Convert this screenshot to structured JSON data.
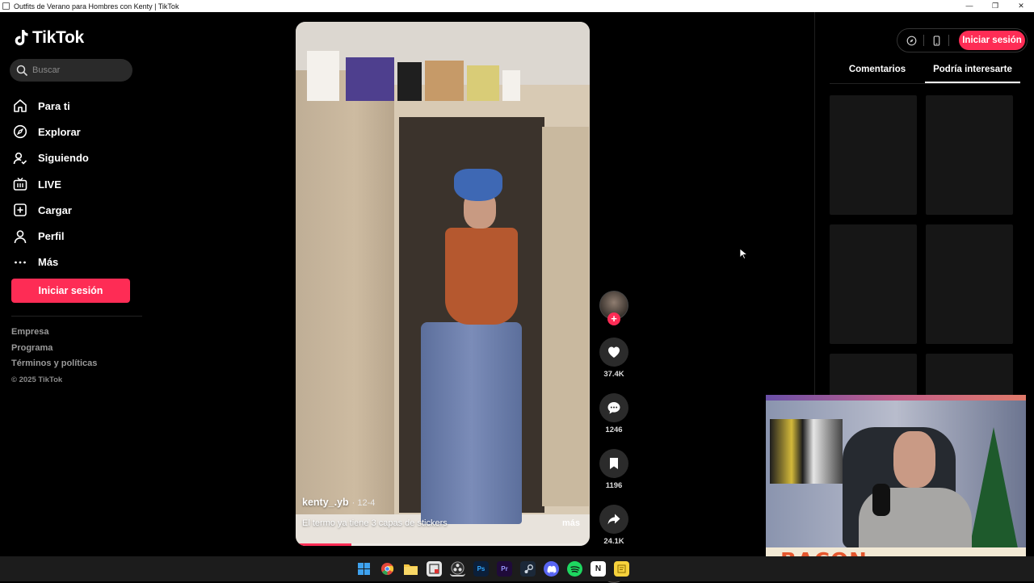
{
  "window": {
    "title": "Outfits de Verano para Hombres con Kenty | TikTok",
    "minimize": "—",
    "maximize": "❐",
    "close": "✕"
  },
  "sidebar": {
    "logo": "TikTok",
    "search_placeholder": "Buscar",
    "nav": [
      {
        "label": "Para ti",
        "icon": "home-icon"
      },
      {
        "label": "Explorar",
        "icon": "compass-icon"
      },
      {
        "label": "Siguiendo",
        "icon": "following-icon"
      },
      {
        "label": "LIVE",
        "icon": "live-icon"
      },
      {
        "label": "Cargar",
        "icon": "upload-icon"
      },
      {
        "label": "Perfil",
        "icon": "profile-icon"
      },
      {
        "label": "Más",
        "icon": "more-icon"
      }
    ],
    "login": "Iniciar sesión",
    "footer": [
      "Empresa",
      "Programa",
      "Términos y políticas"
    ],
    "copyright": "© 2025 TikTok"
  },
  "video": {
    "author": "kenty_.yb",
    "date": "· 12-4",
    "caption": "El termo ya tiene 3 capas de stickers",
    "more": "más",
    "progress": 0.19
  },
  "actions": {
    "likes": "37.4K",
    "comments": "1246",
    "saves": "1196",
    "shares": "24.1K"
  },
  "right_panel": {
    "login": "Iniciar sesión",
    "tabs": [
      "Comentarios",
      "Podría interesarte"
    ],
    "active_tab": 1
  },
  "webcam": {
    "brand": "BACON"
  },
  "colors": {
    "accent": "#fe2c55",
    "background": "#000000"
  }
}
